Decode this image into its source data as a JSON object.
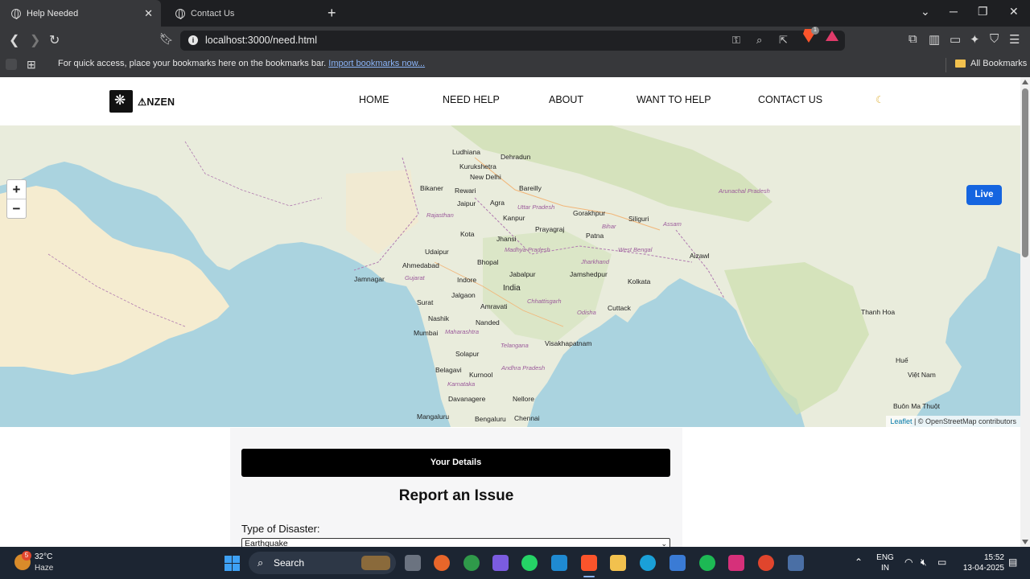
{
  "browser": {
    "tabs": [
      {
        "title": "Help Needed",
        "active": true
      },
      {
        "title": "Contact Us",
        "active": false
      }
    ],
    "new_tab_symbol": "+",
    "url": "localhost:3000/need.html",
    "extension_badge_count": "1",
    "bookmarks_bar": {
      "message": "For quick access, place your bookmarks here on the bookmarks bar.",
      "import_link": "Import bookmarks now...",
      "all_bookmarks": "All Bookmarks"
    }
  },
  "site": {
    "logo_text": "⚠NZEN",
    "nav": [
      "HOME",
      "NEED HELP",
      "ABOUT",
      "WANT TO HELP",
      "CONTACT US"
    ],
    "theme_toggle_icon": "moon-icon"
  },
  "map": {
    "zoom_in": "+",
    "zoom_out": "−",
    "live_button": "Live",
    "attribution_leaflet": "Leaflet",
    "attribution_osm": "| © OpenStreetMap contributors",
    "labels": {
      "ludhiana": "Ludhiana",
      "dehradun": "Dehradun",
      "kurukshetra": "Kurukshetra",
      "new_delhi": "New Delhi",
      "bikaner": "Bikaner",
      "rewari": "Rewari",
      "bareilly": "Bareilly",
      "jaipur": "Jaipur",
      "agra": "Agra",
      "rajasthan": "Rajasthan",
      "uttar_pradesh": "Uttar Pradesh",
      "kanpur": "Kanpur",
      "gorakhpur": "Gorakhpur",
      "siliguri": "Siliguri",
      "prayagraj": "Prayagraj",
      "patna": "Patna",
      "bihar": "Bihar",
      "kota": "Kota",
      "jhansi": "Jhansi",
      "assam": "Assam",
      "udaipur": "Udaipur",
      "bhopal": "Bhopal",
      "madhya_pradesh": "Madhya Pradesh",
      "jharkhand": "Jharkhand",
      "west_bengal": "West Bengal",
      "aizawl": "Aizawl",
      "ahmedabad": "Ahmedabad",
      "jamnagar": "Jamnagar",
      "gujarat": "Gujarat",
      "indore": "Indore",
      "jabalpur": "Jabalpur",
      "jamshedpur": "Jamshedpur",
      "kolkata": "Kolkata",
      "india": "India",
      "chhattisgarh": "Chhattisgarh",
      "surat": "Surat",
      "jalgaon": "Jalgaon",
      "amravati": "Amravati",
      "cuttack": "Cuttack",
      "odisha": "Odisha",
      "nashik": "Nashik",
      "nanded": "Nanded",
      "mumbai": "Mumbai",
      "maharashtra": "Maharashtra",
      "telangana": "Telangana",
      "visakhapatnam": "Visakhapatnam",
      "solapur": "Solapur",
      "belagavi": "Belagavi",
      "kurnool": "Kurnool",
      "andhra_pradesh": "Andhra Pradesh",
      "karnataka": "Karnataka",
      "davanagere": "Davanagere",
      "nellore": "Nellore",
      "mangaluru": "Mangaluru",
      "bengaluru": "Bengaluru",
      "chennai": "Chennai",
      "arunachal_pradesh": "Arunachal Pradesh",
      "thanh_hoa": "Thanh Hoa",
      "hue": "Huế",
      "viet_nam": "Việt Nam",
      "buon_ma_thuot": "Buôn Ma Thuột"
    }
  },
  "form": {
    "details_button": "Your Details",
    "title": "Report an Issue",
    "disaster_label": "Type of Disaster:",
    "disaster_value": "Earthquake"
  },
  "taskbar": {
    "weather_badge": "5",
    "temperature": "32°C",
    "condition": "Haze",
    "search_label": "Search",
    "language": "ENG",
    "region": "IN",
    "time": "15:52",
    "date": "13-04-2025"
  }
}
